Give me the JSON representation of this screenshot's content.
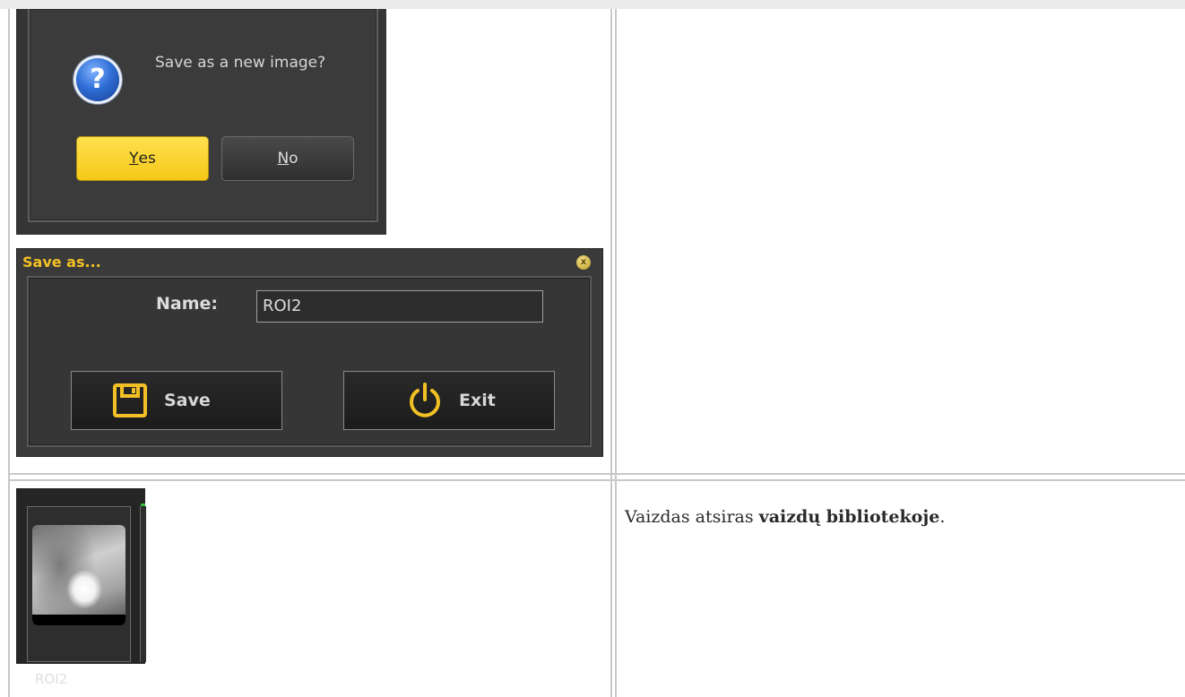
{
  "confirm_dialog": {
    "message": "Save as a new image?",
    "yes_mnemonic": "Y",
    "yes_rest": "es",
    "no_mnemonic": "N",
    "no_rest": "o"
  },
  "save_as_dialog": {
    "title": "Save as...",
    "name_label": "Name:",
    "name_value": "ROI2",
    "save_label": "Save",
    "exit_label": "Exit"
  },
  "library": {
    "thumbnail_label": "ROI2"
  },
  "caption": {
    "prefix": "Vaizdas atsiras ",
    "bold": "vaizdų bibliotekoje",
    "suffix": "."
  },
  "colors": {
    "dialog_bg": "#3b3b3b",
    "accent_yellow": "#f5c816",
    "title_yellow": "#f2c025"
  }
}
